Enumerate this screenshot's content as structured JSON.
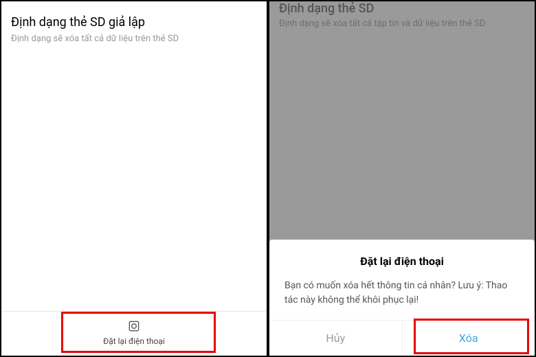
{
  "leftScreen": {
    "title": "Định dạng thẻ SD giả lập",
    "subtitle": "Định dạng sẽ xóa tất cả dữ liệu trên thẻ SD",
    "resetButton": {
      "label": "Đặt lại điện thoại",
      "iconName": "reset-icon"
    }
  },
  "rightScreen": {
    "dimmedTitle": "Định dạng thẻ SD",
    "dimmedSubtitle": "Định dạng sẽ xóa tất cả tập tin và dữ liệu trên thẻ SD",
    "dialog": {
      "title": "Đặt lại điện thoại",
      "message": "Bạn có muốn xóa hết thông tin cá nhân? Lưu ý: Thao tác này không thể khôi phục lại!",
      "cancelLabel": "Hủy",
      "confirmLabel": "Xóa"
    }
  }
}
